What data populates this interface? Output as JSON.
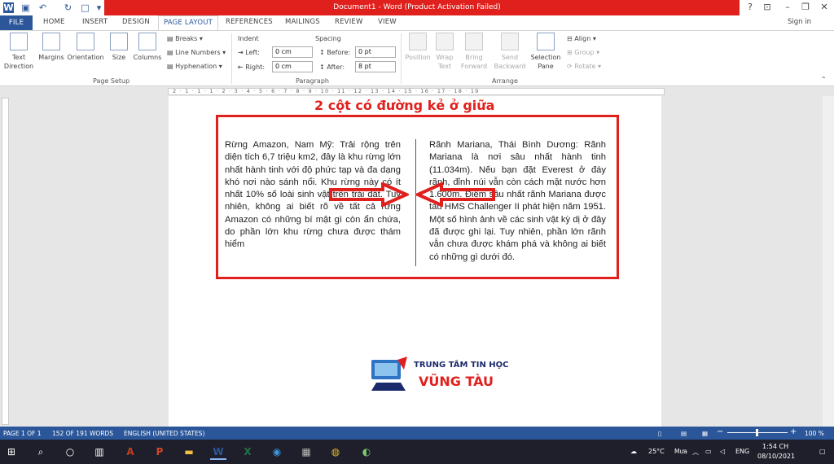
{
  "window": {
    "title": "Document1 - Word (Product Activation Failed)"
  },
  "tabs": [
    "FILE",
    "HOME",
    "INSERT",
    "DESIGN",
    "PAGE LAYOUT",
    "REFERENCES",
    "MAILINGS",
    "REVIEW",
    "VIEW"
  ],
  "active_tab": "PAGE LAYOUT",
  "signin": "Sign in",
  "ribbon": {
    "page_setup": {
      "label": "Page Setup",
      "text_direction": "Text Direction",
      "margins": "Margins",
      "orientation": "Orientation",
      "size": "Size",
      "columns": "Columns",
      "breaks": "Breaks",
      "line_numbers": "Line Numbers",
      "hyphenation": "Hyphenation"
    },
    "paragraph": {
      "label": "Paragraph",
      "indent_label": "Indent",
      "spacing_label": "Spacing",
      "left_label": "Left:",
      "right_label": "Right:",
      "before_label": "Before:",
      "after_label": "After:",
      "left_value": "0 cm",
      "right_value": "0 cm",
      "before_value": "0 pt",
      "after_value": "8 pt"
    },
    "arrange": {
      "label": "Arrange",
      "position": "Position",
      "wrap_text": "Wrap Text",
      "bring_forward": "Bring Forward",
      "send_backward": "Send Backward",
      "selection_pane": "Selection Pane",
      "align": "Align",
      "group": "Group",
      "rotate": "Rotate"
    }
  },
  "ruler_numbers": "2 · 1 · 1 · 1 · 2 · 3 · 4 · 5 · 6 · 7 · 8 · 9 · 10 · 11 · 12 · 13 · 14 · 15 · 16 · 17 · 18 · 19",
  "document": {
    "heading": "2 cột có đường kẻ ở giữa",
    "column1": "Rừng Amazon, Nam Mỹ: Trải rộng trên diện tích 6,7 triệu km2, đây là khu rừng lớn nhất hành tinh với độ phức tạp và đa dạng khó nơi nào sánh nổi. Khu rừng này có ít nhất 10% số loài sinh vật trên trái đất. Tuy nhiên, không ai biết rõ về tất cả rừng Amazon có những bí mật gì còn ẩn chứa, do phần lớn khu rừng chưa được thám hiểm",
    "column2": "Rãnh Mariana, Thái Bình Dương: Rãnh Mariana là nơi sâu nhất hành tinh (11.034m). Nếu bạn đặt Everest ở đáy rãnh, đỉnh núi vẫn còn cách mặt nước hơn 1.600m. Điểm sâu nhất rãnh Mariana được tàu HMS Challenger II phát hiện năm 1951. Một số hình ảnh về các sinh vật kỳ dị ở đây đã được ghi lại. Tuy nhiên, phần lớn rãnh vẫn chưa được khám phá và không ai biết có những gì dưới đó."
  },
  "logo": {
    "line1": "TRUNG TÂM TIN HỌC",
    "line2": "VŨNG TÀU"
  },
  "status": {
    "page": "PAGE 1 OF 1",
    "words": "152 OF 191 WORDS",
    "language": "ENGLISH (UNITED STATES)",
    "zoom": "100 %"
  },
  "taskbar": {
    "weather": "25°C",
    "weather_desc": "Mưa",
    "lang": "ENG",
    "time": "1:54 CH",
    "date": "08/10/2021"
  },
  "colors": {
    "accent": "#2b579a",
    "red": "#e0201d"
  }
}
